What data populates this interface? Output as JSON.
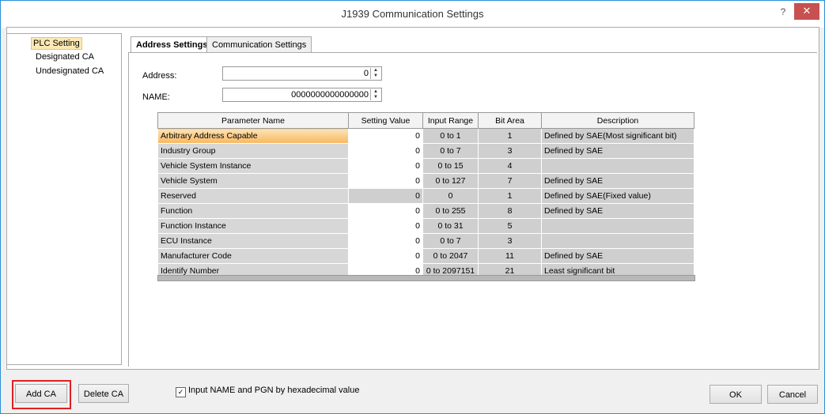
{
  "window": {
    "title": "J1939 Communication Settings",
    "help": "?",
    "close": "✕"
  },
  "tree": [
    "PLC Setting",
    "Designated CA",
    "Undesignated CA"
  ],
  "tabs": [
    "Address Settings",
    "Communication Settings"
  ],
  "form": {
    "address_label": "Address:",
    "address_value": "0",
    "name_label": "NAME:",
    "name_value": "0000000000000000"
  },
  "grid": {
    "headers": [
      "Parameter Name",
      "Setting Value",
      "Input Range",
      "Bit Area",
      "Description"
    ],
    "rows": [
      [
        "Arbitrary Address Capable",
        "0",
        "0 to 1",
        "1",
        "Defined by SAE(Most significant bit)"
      ],
      [
        "Industry Group",
        "0",
        "0 to 7",
        "3",
        "Defined by SAE"
      ],
      [
        "Vehicle System Instance",
        "0",
        "0 to 15",
        "4",
        ""
      ],
      [
        "Vehicle System",
        "0",
        "0 to 127",
        "7",
        "Defined by SAE"
      ],
      [
        "Reserved",
        "0",
        "0",
        "1",
        "Defined by SAE(Fixed value)"
      ],
      [
        "Function",
        "0",
        "0 to 255",
        "8",
        "Defined by SAE"
      ],
      [
        "Function Instance",
        "0",
        "0 to 31",
        "5",
        ""
      ],
      [
        "ECU Instance",
        "0",
        "0 to 7",
        "3",
        ""
      ],
      [
        "Manufacturer Code",
        "0",
        "0 to 2047",
        "11",
        "Defined by SAE"
      ],
      [
        "Identify Number",
        "0",
        "0 to 2097151",
        "21",
        "Least significant bit"
      ]
    ]
  },
  "buttons": {
    "add": "Add CA",
    "delete": "Delete CA",
    "ok": "OK",
    "cancel": "Cancel"
  },
  "checkbox": {
    "label": "Input NAME and PGN by hexadecimal value",
    "checked": true
  }
}
